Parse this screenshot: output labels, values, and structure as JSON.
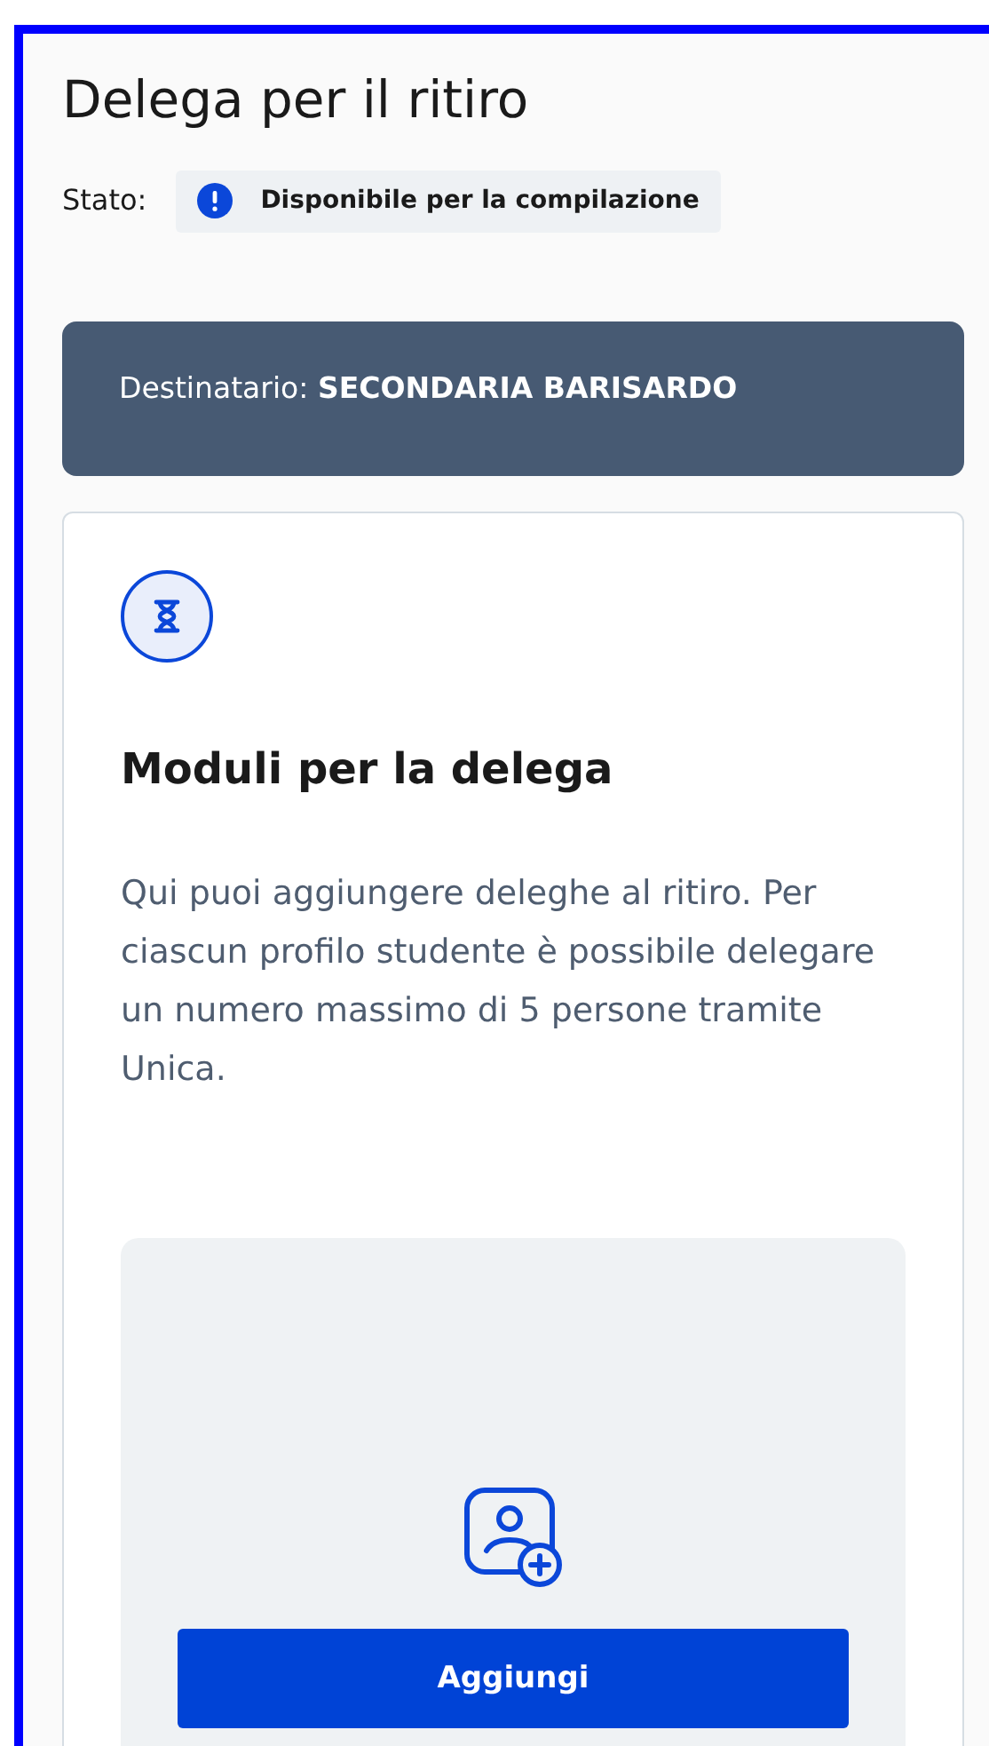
{
  "title": "Delega per il ritiro",
  "status": {
    "label": "Stato:",
    "value": "Disponibile per la compilazione",
    "kind": "info"
  },
  "recipient": {
    "label": "Destinatario:",
    "value": "SECONDARIA BARISARDO"
  },
  "card": {
    "heading": "Moduli per la delega",
    "text": "Qui puoi aggiungere deleghe al ritiro. Per ciascun profilo studente è possibile delegare un numero massimo di 5 persone tramite Unica."
  },
  "add_panel": {
    "button": "Aggiungi"
  }
}
